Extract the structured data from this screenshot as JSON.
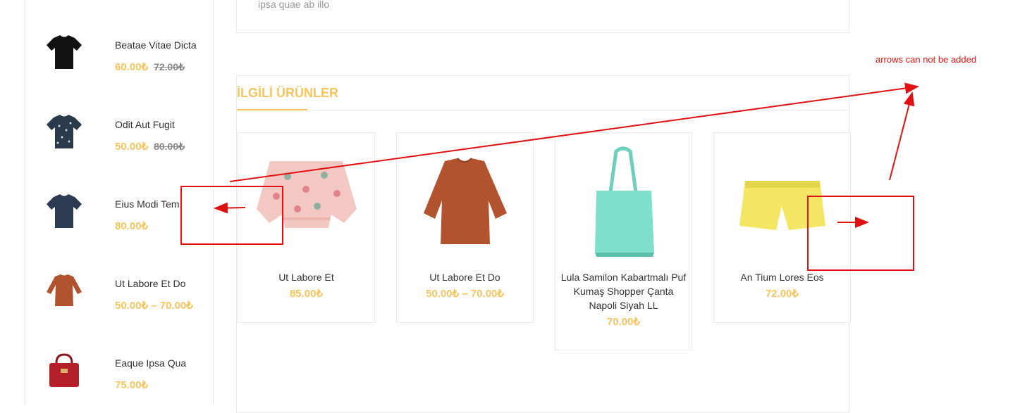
{
  "sidebar": {
    "items": [
      {
        "name": "Beatae Vitae Dicta",
        "price": "60.00₺",
        "old_price": "72.00₺",
        "thumb": "black-tshirt"
      },
      {
        "name": "Odit Aut Fugit",
        "price": "50.00₺",
        "old_price": "80.00₺",
        "thumb": "patterned-tshirt"
      },
      {
        "name": "Eius Modi Tem",
        "price": "80.00₺",
        "old_price": "",
        "thumb": "navy-tshirt"
      },
      {
        "name": "Ut Labore Et Do",
        "price": "50.00₺ – 70.00₺",
        "old_price": "",
        "thumb": "rust-sweater"
      },
      {
        "name": "Eaque Ipsa Qua",
        "price": "75.00₺",
        "old_price": "",
        "thumb": "red-handbag"
      }
    ]
  },
  "description": {
    "text": "ipsa quae ab illo"
  },
  "related": {
    "title": "İLGİLİ ÜRÜNLER",
    "products": [
      {
        "name": "Ut Labore Et",
        "price": "85.00₺",
        "image": "floral-blouse"
      },
      {
        "name": "Ut Labore Et Do",
        "price": "50.00₺ – 70.00₺",
        "image": "rust-sweater"
      },
      {
        "name": "Lula Samilon Kabartmalı Puf Kumaş Shopper Çanta Napoli Siyah LL",
        "price": "70.00₺",
        "image": "mint-tote-bag"
      },
      {
        "name": "An Tium Lores Eos",
        "price": "72.00₺",
        "image": "yellow-shorts"
      }
    ]
  },
  "annotation": {
    "note": "arrows can not be added",
    "color": "#e11111"
  },
  "colors": {
    "accent": "#f7c55f",
    "border": "#ebebeb"
  }
}
